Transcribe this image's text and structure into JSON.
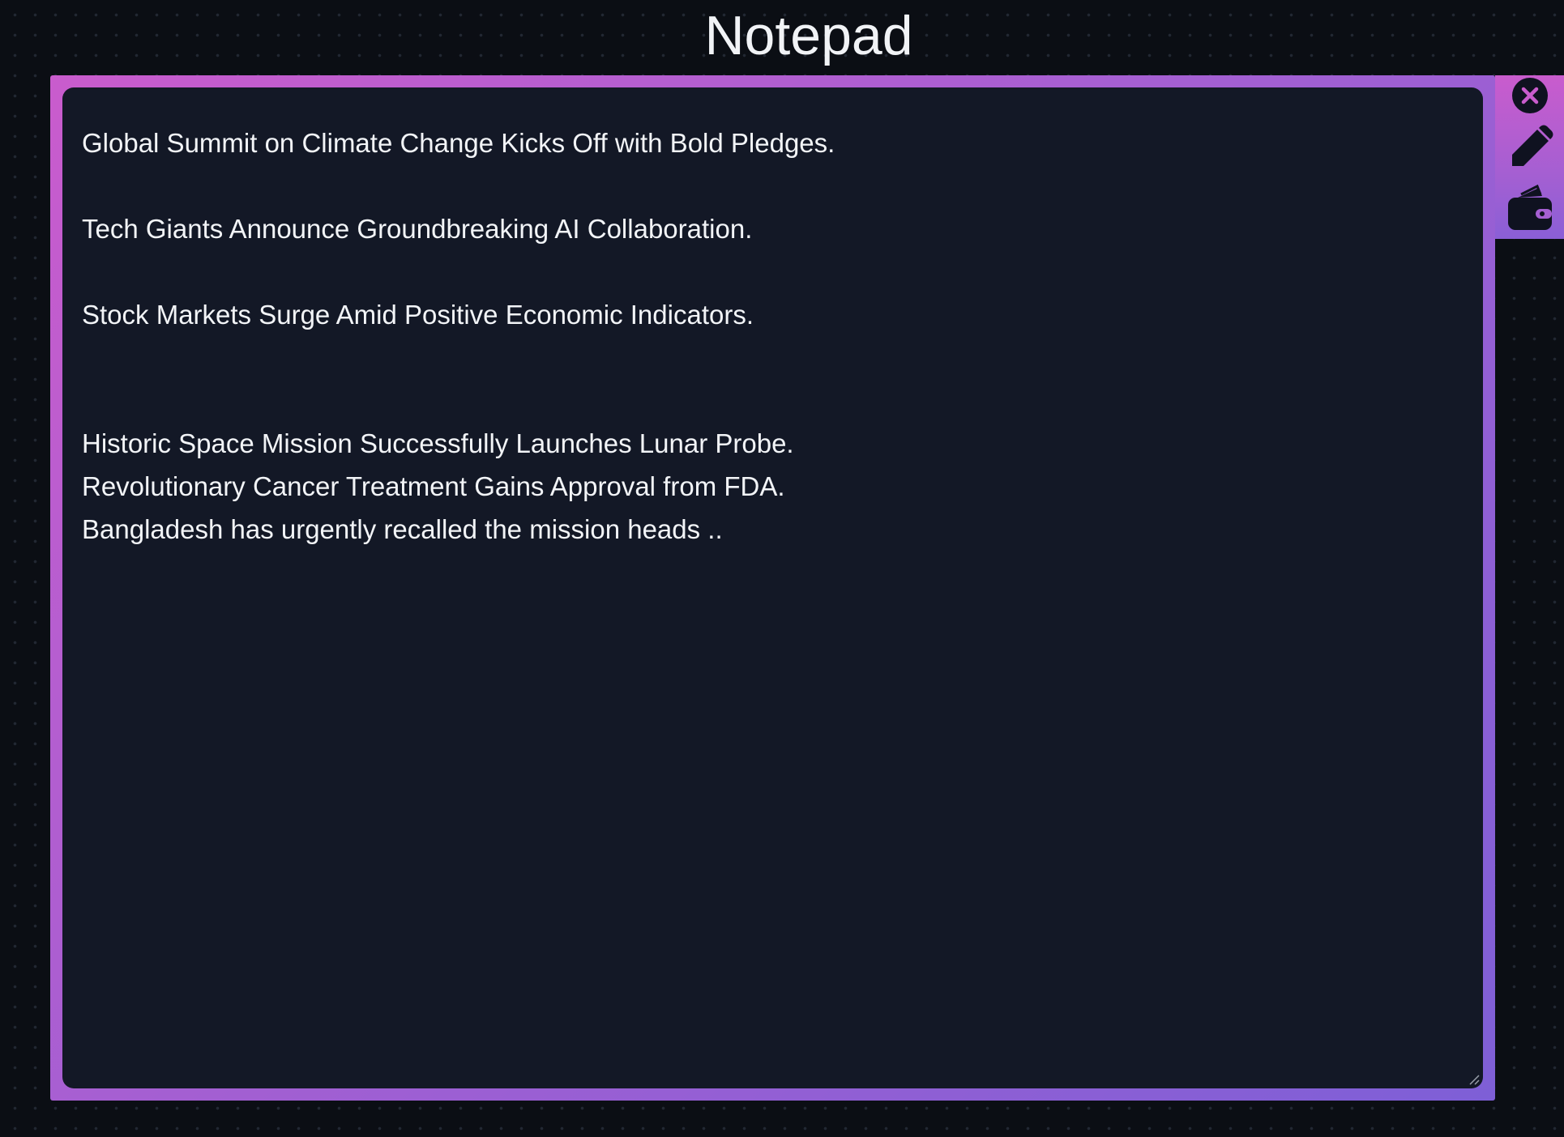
{
  "app": {
    "title": "Notepad"
  },
  "editor": {
    "lines": [
      "Global Summit on Climate Change Kicks Off with Bold Pledges.",
      "",
      "Tech Giants Announce Groundbreaking AI Collaboration.",
      "",
      "Stock Markets Surge Amid Positive Economic Indicators.",
      "",
      "",
      "Historic Space Mission Successfully Launches Lunar Probe.",
      "Revolutionary Cancer Treatment Gains Approval from FDA.",
      "Bangladesh has urgently recalled the mission heads .."
    ]
  },
  "toolbar": {
    "items": [
      {
        "name": "close",
        "icon": "close-circle-icon"
      },
      {
        "name": "edit",
        "icon": "pencil-icon"
      },
      {
        "name": "wallet",
        "icon": "wallet-icon"
      }
    ]
  },
  "colors": {
    "background": "#0b0e14",
    "frame_gradient_start": "#c95ccd",
    "frame_gradient_end": "#7e5fd6",
    "editor_background": "#131826",
    "text": "#f2f4f7"
  }
}
